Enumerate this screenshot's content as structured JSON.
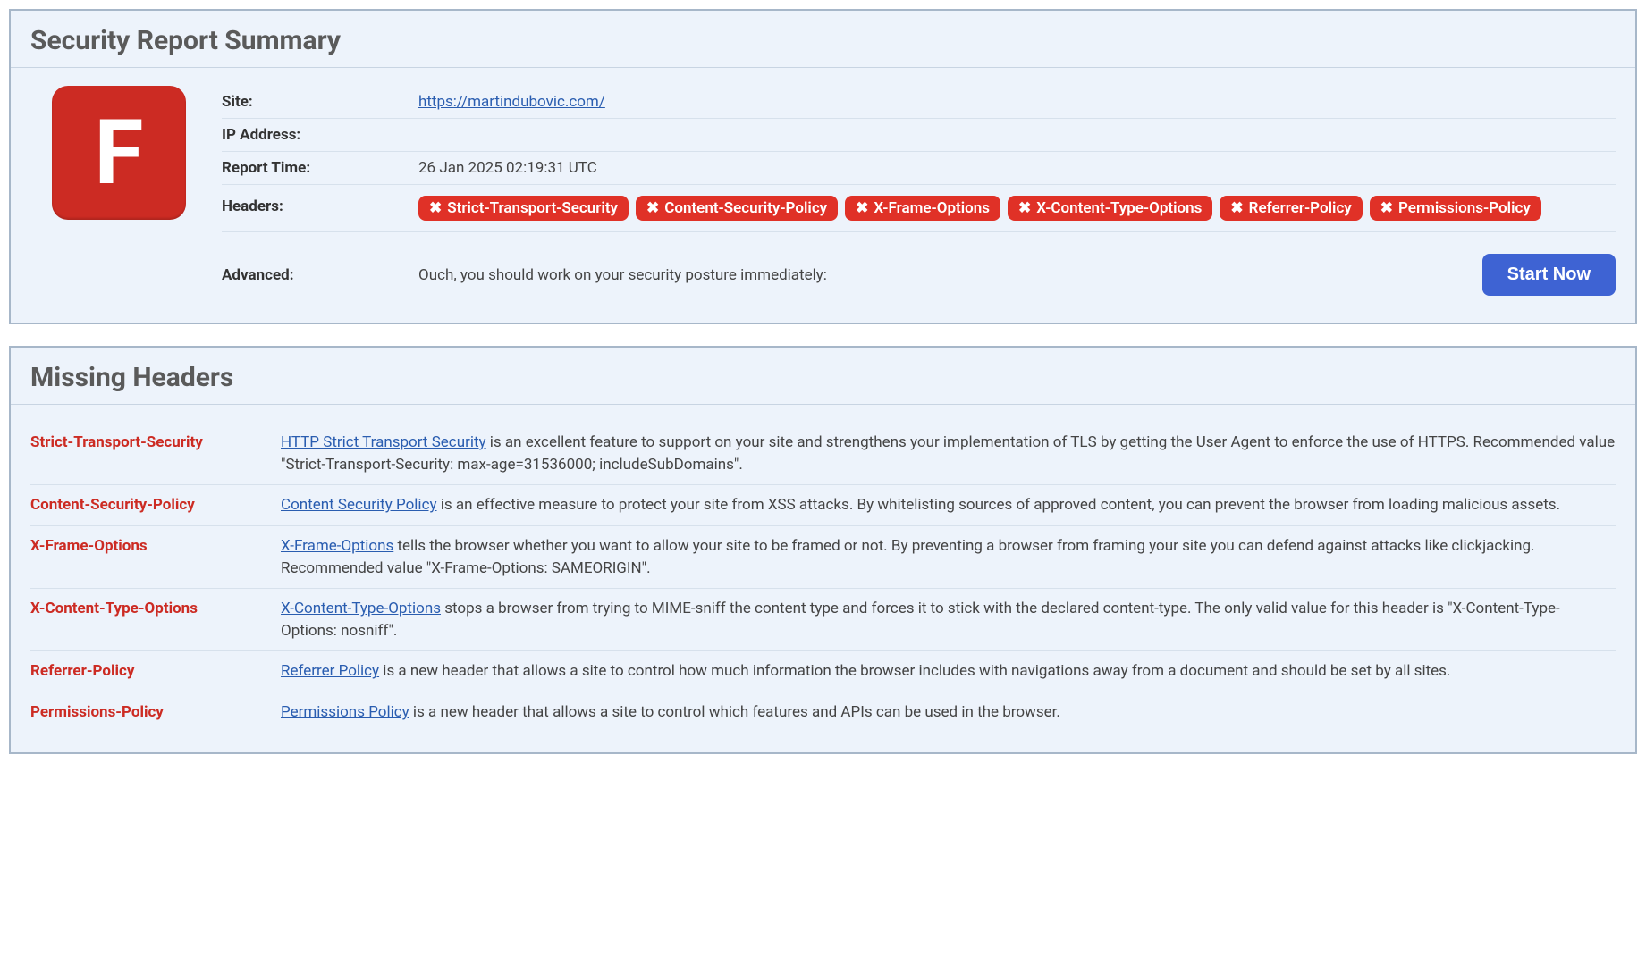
{
  "summary": {
    "title": "Security Report Summary",
    "grade": "F",
    "rows": {
      "site": {
        "label": "Site:",
        "value": "https://martindubovic.com/"
      },
      "ip": {
        "label": "IP Address:",
        "value": ""
      },
      "report_time": {
        "label": "Report Time:",
        "value": "26 Jan 2025 02:19:31 UTC"
      },
      "headers_label": "Headers:",
      "headers": [
        "Strict-Transport-Security",
        "Content-Security-Policy",
        "X-Frame-Options",
        "X-Content-Type-Options",
        "Referrer-Policy",
        "Permissions-Policy"
      ],
      "advanced": {
        "label": "Advanced:",
        "text": "Ouch, you should work on your security posture immediately:",
        "button": "Start Now"
      }
    }
  },
  "missing": {
    "title": "Missing Headers",
    "items": [
      {
        "name": "Strict-Transport-Security",
        "link_text": "HTTP Strict Transport Security",
        "desc": " is an excellent feature to support on your site and strengthens your implementation of TLS by getting the User Agent to enforce the use of HTTPS. Recommended value \"Strict-Transport-Security: max-age=31536000; includeSubDomains\"."
      },
      {
        "name": "Content-Security-Policy",
        "link_text": "Content Security Policy",
        "desc": " is an effective measure to protect your site from XSS attacks. By whitelisting sources of approved content, you can prevent the browser from loading malicious assets."
      },
      {
        "name": "X-Frame-Options",
        "link_text": "X-Frame-Options",
        "desc": " tells the browser whether you want to allow your site to be framed or not. By preventing a browser from framing your site you can defend against attacks like clickjacking. Recommended value \"X-Frame-Options: SAMEORIGIN\"."
      },
      {
        "name": "X-Content-Type-Options",
        "link_text": "X-Content-Type-Options",
        "desc": " stops a browser from trying to MIME-sniff the content type and forces it to stick with the declared content-type. The only valid value for this header is \"X-Content-Type-Options: nosniff\"."
      },
      {
        "name": "Referrer-Policy",
        "link_text": "Referrer Policy",
        "desc": " is a new header that allows a site to control how much information the browser includes with navigations away from a document and should be set by all sites."
      },
      {
        "name": "Permissions-Policy",
        "link_text": "Permissions Policy",
        "desc": " is a new header that allows a site to control which features and APIs can be used in the browser."
      }
    ]
  }
}
